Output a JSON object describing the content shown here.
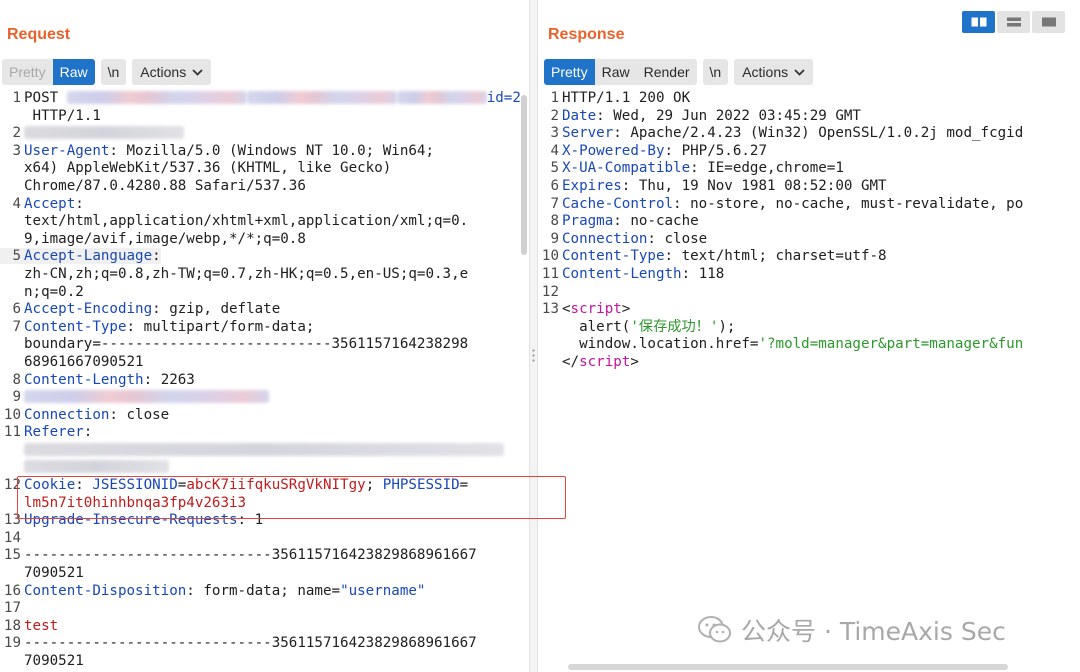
{
  "request": {
    "title": "Request",
    "toolbar": {
      "pretty": "Pretty",
      "raw": "Raw",
      "newline": "\\n",
      "actions": "Actions"
    },
    "lines": {
      "l1_method": "POST",
      "l1_tail": "id=2",
      "l1b": " HTTP/1.1",
      "l3_key": "User-Agent",
      "l3_val": "Mozilla/5.0 (Windows NT 10.0; Win64;",
      "l3b": "x64) AppleWebKit/537.36 (KHTML, like Gecko)",
      "l3c": "Chrome/87.0.4280.88 Safari/537.36",
      "l4_key": "Accept",
      "l4b": "text/html,application/xhtml+xml,application/xml;q=0.",
      "l4c": "9,image/avif,image/webp,*/*;q=0.8",
      "l5_key": "Accept-Language",
      "l5b": "zh-CN,zh;q=0.8,zh-TW;q=0.7,zh-HK;q=0.5,en-US;q=0.3,e",
      "l5c": "n;q=0.2",
      "l6_key": "Accept-Encoding",
      "l6_val": "gzip, deflate",
      "l7_key": "Content-Type",
      "l7_val": "multipart/form-data;",
      "l7b": "boundary=---------------------------3561157164238298",
      "l7c": "68961667090521",
      "l8_key": "Content-Length",
      "l8_val": "2263",
      "l10_key": "Connection",
      "l10_val": "close",
      "l11_key": "Referer",
      "l12_key": "Cookie",
      "l12_n1": "JSESSIONID",
      "l12_v1": "abcK7iifqkuSRgVkNITgy",
      "l12_n2": "PHPSESSID",
      "l12b": "lm5n7it0hinhbnqa3fp4v263i3",
      "l13_key": "Upgrade-Insecure-Requests",
      "l13_val": "1",
      "l15": "-----------------------------356115716423829868961667",
      "l15b": "7090521",
      "l16_key": "Content-Disposition",
      "l16_val": "form-data; name=",
      "l16_str": "\"username\"",
      "l18": "test",
      "l19": "-----------------------------356115716423829868961667",
      "l19b": "7090521"
    }
  },
  "response": {
    "title": "Response",
    "toolbar": {
      "pretty": "Pretty",
      "raw": "Raw",
      "render": "Render",
      "newline": "\\n",
      "actions": "Actions"
    },
    "lines": {
      "l1": "HTTP/1.1 200 OK",
      "l2_key": "Date",
      "l2_val": "Wed, 29 Jun 2022 03:45:29 GMT",
      "l3_key": "Server",
      "l3_val": "Apache/2.4.23 (Win32) OpenSSL/1.0.2j mod_fcgid",
      "l4_key": "X-Powered-By",
      "l4_val": "PHP/5.6.27",
      "l5_key": "X-UA-Compatible",
      "l5_val": "IE=edge,chrome=1",
      "l6_key": "Expires",
      "l6_val": "Thu, 19 Nov 1981 08:52:00 GMT",
      "l7_key": "Cache-Control",
      "l7_val": "no-store, no-cache, must-revalidate, po",
      "l8_key": "Pragma",
      "l8_val": "no-cache",
      "l9_key": "Connection",
      "l9_val": "close",
      "l10_key": "Content-Type",
      "l10_val": "text/html; charset=utf-8",
      "l11_key": "Content-Length",
      "l11_val": "118",
      "l13_tag": "script",
      "l14_fn": "  alert(",
      "l14_str": "'保存成功！'",
      "l14_end": ");",
      "l15_code": "  window.location.href=",
      "l15_str": "'?mold=manager&part=manager&fun",
      "l16_tag": "script"
    }
  },
  "watermark": {
    "text": "公众号 · TimeAxis Sec"
  }
}
